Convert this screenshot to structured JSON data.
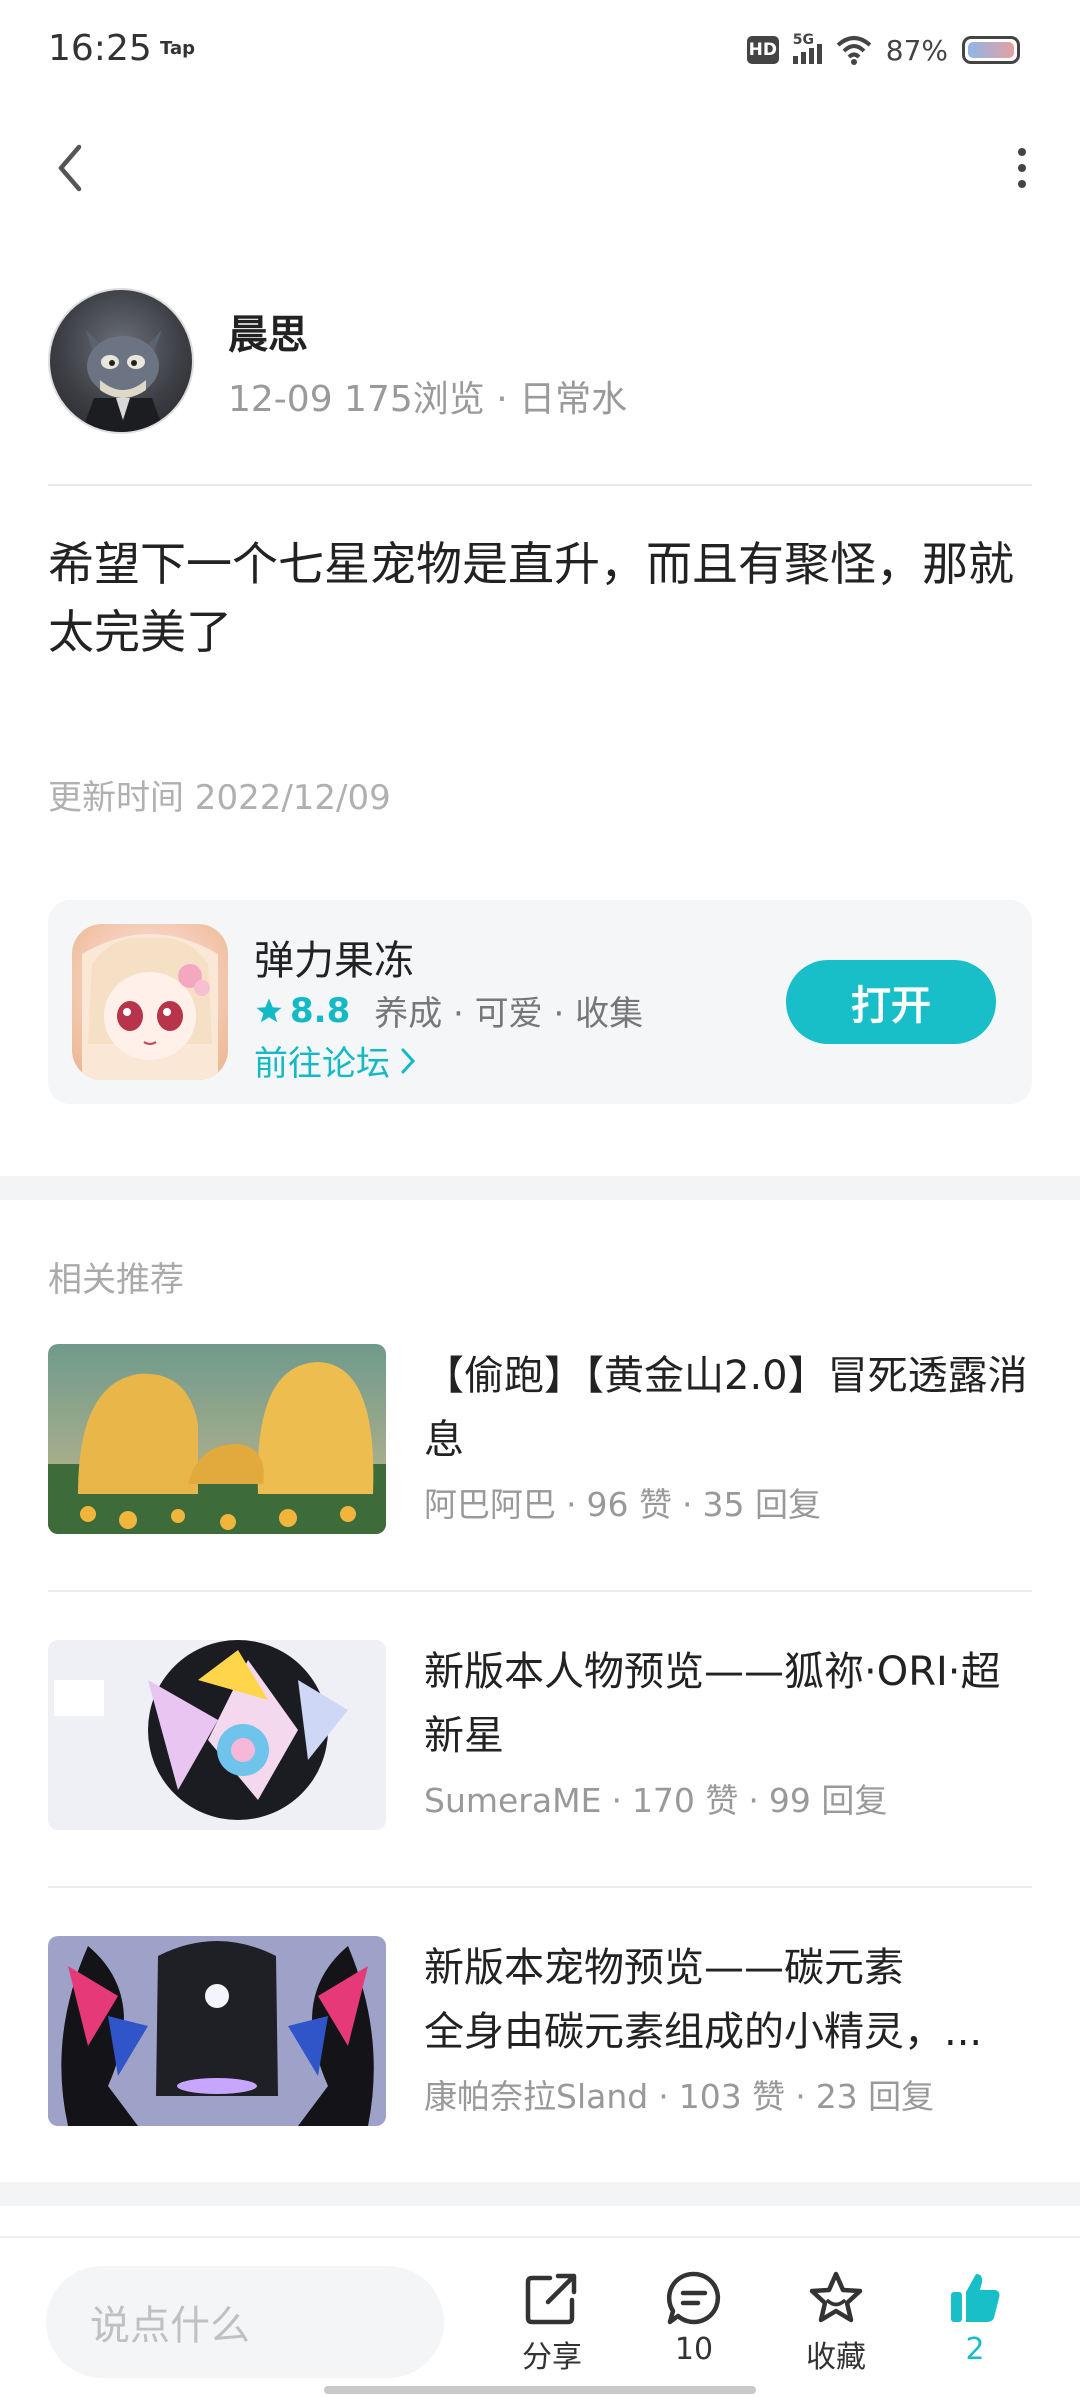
{
  "status_bar": {
    "time": "16:25",
    "app_tag": "Tap",
    "hd": "HD",
    "network": "5G",
    "battery_percent": "87%"
  },
  "post": {
    "author_name": "晨思",
    "author_meta": "12-09  175浏览 · 日常水",
    "content": "希望下一个七星宠物是直升，而且有聚怪，那就太完美了",
    "update_time": "更新时间 2022/12/09"
  },
  "game_card": {
    "name": "弹力果冻",
    "rating": "8.8",
    "tags": "养成 · 可爱 · 收集",
    "forum_link": "前往论坛",
    "open_label": "打开"
  },
  "recommendations": {
    "title": "相关推荐",
    "items": [
      {
        "title": "【偷跑】【黄金山2.0】冒死透露消息",
        "author": "阿巴阿巴",
        "likes": "96 赞",
        "replies": "35 回复"
      },
      {
        "title": "新版本人物预览——狐祢·ORI·超新星",
        "author": "SumeraME",
        "likes": "170 赞",
        "replies": "99 回复"
      },
      {
        "title": "新版本宠物预览——碳元素",
        "subtitle": "全身由碳元素组成的小精灵，...",
        "author": "康帕奈拉Sland",
        "likes": "103 赞",
        "replies": "23 回复"
      }
    ]
  },
  "bottom_bar": {
    "comment_placeholder": "说点什么",
    "share_label": "分享",
    "comment_count": "10",
    "favorite_label": "收藏",
    "like_count": "2",
    "accent_color": "#18bfc8"
  }
}
